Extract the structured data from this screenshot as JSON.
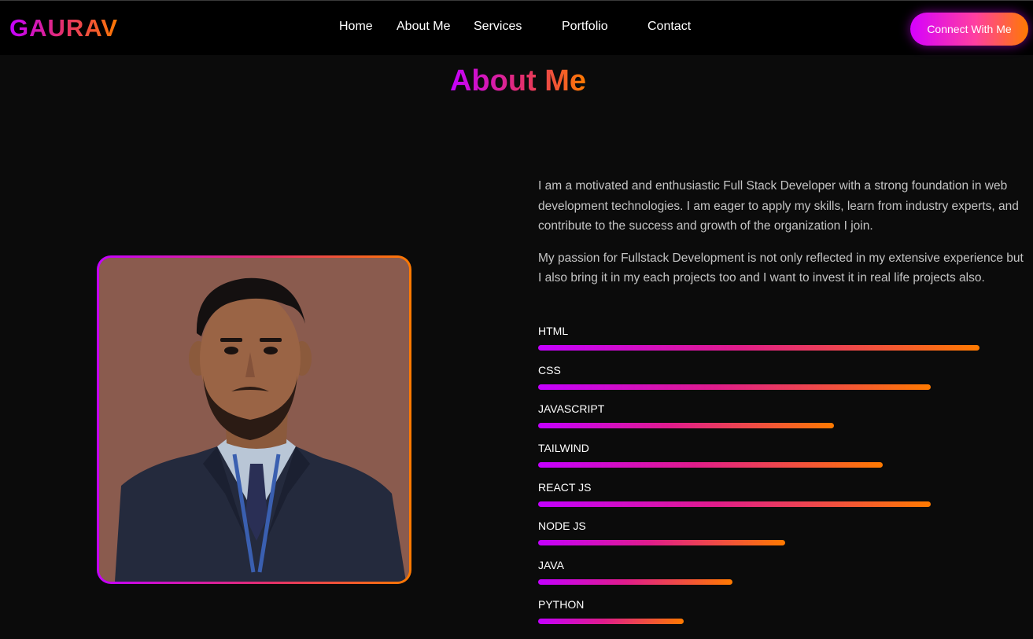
{
  "brand": {
    "logo_text": "GAURAV"
  },
  "nav": {
    "links": [
      {
        "label": "Home"
      },
      {
        "label": "About Me"
      },
      {
        "label": "Services"
      },
      {
        "label": "Portfolio"
      },
      {
        "label": "Contact"
      }
    ],
    "cta_label": "Connect With Me"
  },
  "about": {
    "title": "About Me",
    "paragraphs": [
      "I am a motivated and enthusiastic Full Stack Developer with a strong foundation in web development technologies. I am eager to apply my skills, learn from industry experts, and contribute to the success and growth of the organization I join.",
      "My passion for Fullstack Development is not only reflected in my extensive experience but I also bring it in my each projects too and I want to invest it in real life projects also."
    ],
    "skills": [
      {
        "name": "HTML",
        "level": 1.0
      },
      {
        "name": "CSS",
        "level": 0.89
      },
      {
        "name": "JAVASCRIPT",
        "level": 0.67
      },
      {
        "name": "TAILWIND",
        "level": 0.78
      },
      {
        "name": "REACT JS",
        "level": 0.89
      },
      {
        "name": "NODE JS",
        "level": 0.56
      },
      {
        "name": "JAVA",
        "level": 0.44
      },
      {
        "name": "PYTHON",
        "level": 0.33
      }
    ]
  },
  "theme": {
    "gradient_start": "#c400ff",
    "gradient_mid": "#e4306a",
    "gradient_end": "#ff7a00",
    "background": "#0b0b0b"
  },
  "icons": {
    "profile_photo": "portrait-photo"
  }
}
